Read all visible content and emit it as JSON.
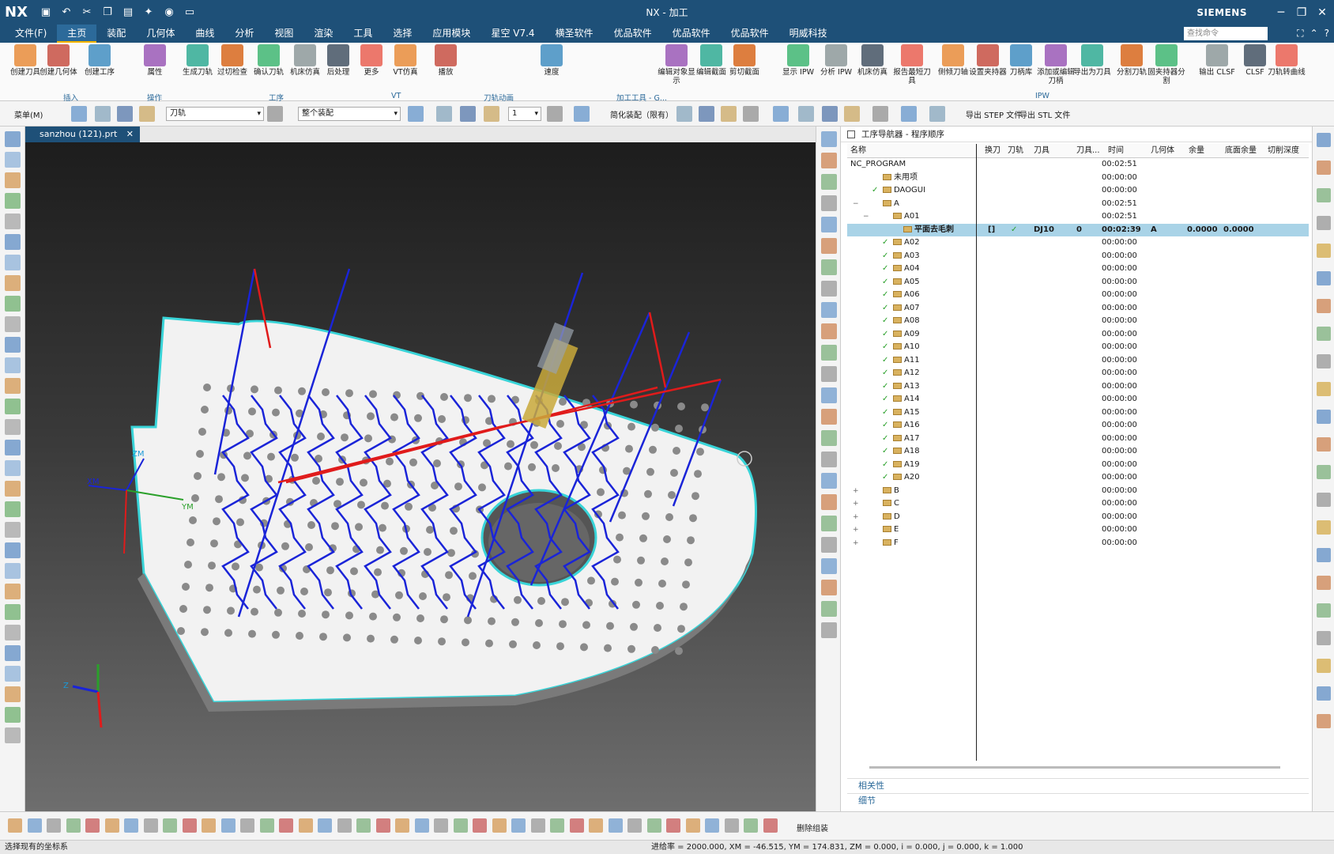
{
  "titlebar": {
    "logo": "NX",
    "title": "NX - 加工",
    "brand": "SIEMENS",
    "window_controls": [
      "minimize-icon",
      "restore-icon",
      "close-icon"
    ]
  },
  "menubar": {
    "items": [
      "文件(F)",
      "主页",
      "装配",
      "几何体",
      "曲线",
      "分析",
      "视图",
      "渲染",
      "工具",
      "选择",
      "应用模块",
      "星空 V7.4",
      "横圣软件",
      "优品软件",
      "优品软件",
      "优品软件",
      "明威科技"
    ],
    "active": "主页",
    "search_placeholder": "查找命令"
  },
  "ribbon": {
    "buttons": [
      "创建刀具",
      "创建几何体",
      "创建工序",
      "属性",
      "生成刀轨",
      "过切检查",
      "确认刀轨",
      "机床仿真",
      "后处理",
      "更多",
      "VT仿真",
      "播放",
      "速度",
      "编辑对象显示",
      "编辑截面",
      "剪切截面",
      "显示 IPW",
      "分析 IPW",
      "机床仿真",
      "报告最短刀具",
      "侧倾刀轴",
      "设置夹持器",
      "刀柄库",
      "添加或编辑刀柄",
      "导出为刀具",
      "分割刀轨",
      "固夹持器分割",
      "输出 CLSF",
      "CLSF",
      "刀轨转曲线"
    ],
    "groups": [
      "插入",
      "操作",
      "工序",
      "VT",
      "刀轨动画",
      "加工工具 - G...",
      "IPW"
    ]
  },
  "toolbar2": {
    "menu_label": "菜单(M)",
    "filter_combo": "刀轨",
    "scope_combo": "整个装配",
    "layer_combo": "1",
    "simplified_label": "简化装配（限有）",
    "export_step": "导出 STEP 文件",
    "export_stl": "导出 STL 文件"
  },
  "filetab": {
    "name": "sanzhou (121).prt"
  },
  "viewport": {
    "axis_labels": [
      "ZM",
      "YM",
      "XM",
      "Z"
    ]
  },
  "navigator": {
    "title": "工序导航器 - 程序顺序",
    "columns": [
      "名称",
      "换刀",
      "刀轨",
      "刀具",
      "刀具...",
      "时间",
      "几何体",
      "余量",
      "底面余量",
      "切削深度"
    ],
    "rows": [
      {
        "name": "NC_PROGRAM",
        "time": "00:02:51",
        "level": 0
      },
      {
        "name": "未用项",
        "time": "00:00:00",
        "level": 1
      },
      {
        "name": "DAOGUI",
        "time": "00:00:00",
        "level": 1,
        "check": true
      },
      {
        "name": "A",
        "time": "00:02:51",
        "level": 1,
        "expanded": true
      },
      {
        "name": "A01",
        "time": "00:02:51",
        "level": 2,
        "expanded": true
      },
      {
        "name": "平面去毛刺",
        "time": "00:02:39",
        "level": 3,
        "selected": true,
        "tool": "DJ10",
        "tool_no": "0",
        "geometry": "A",
        "stock": "0.0000",
        "floor_stock": "0.0000",
        "toolchange": "[]",
        "path_ok": true
      },
      {
        "name": "A02",
        "time": "00:00:00",
        "level": 2,
        "check": true
      },
      {
        "name": "A03",
        "time": "00:00:00",
        "level": 2,
        "check": true
      },
      {
        "name": "A04",
        "time": "00:00:00",
        "level": 2,
        "check": true
      },
      {
        "name": "A05",
        "time": "00:00:00",
        "level": 2,
        "check": true
      },
      {
        "name": "A06",
        "time": "00:00:00",
        "level": 2,
        "check": true
      },
      {
        "name": "A07",
        "time": "00:00:00",
        "level": 2,
        "check": true
      },
      {
        "name": "A08",
        "time": "00:00:00",
        "level": 2,
        "check": true
      },
      {
        "name": "A09",
        "time": "00:00:00",
        "level": 2,
        "check": true
      },
      {
        "name": "A10",
        "time": "00:00:00",
        "level": 2,
        "check": true
      },
      {
        "name": "A11",
        "time": "00:00:00",
        "level": 2,
        "check": true
      },
      {
        "name": "A12",
        "time": "00:00:00",
        "level": 2,
        "check": true
      },
      {
        "name": "A13",
        "time": "00:00:00",
        "level": 2,
        "check": true
      },
      {
        "name": "A14",
        "time": "00:00:00",
        "level": 2,
        "check": true
      },
      {
        "name": "A15",
        "time": "00:00:00",
        "level": 2,
        "check": true
      },
      {
        "name": "A16",
        "time": "00:00:00",
        "level": 2,
        "check": true
      },
      {
        "name": "A17",
        "time": "00:00:00",
        "level": 2,
        "check": true
      },
      {
        "name": "A18",
        "time": "00:00:00",
        "level": 2,
        "check": true
      },
      {
        "name": "A19",
        "time": "00:00:00",
        "level": 2,
        "check": true
      },
      {
        "name": "A20",
        "time": "00:00:00",
        "level": 2,
        "check": true
      },
      {
        "name": "B",
        "time": "00:00:00",
        "level": 1,
        "collapsed": true
      },
      {
        "name": "C",
        "time": "00:00:00",
        "level": 1,
        "collapsed": true
      },
      {
        "name": "D",
        "time": "00:00:00",
        "level": 1,
        "collapsed": true
      },
      {
        "name": "E",
        "time": "00:00:00",
        "level": 1,
        "collapsed": true
      },
      {
        "name": "F",
        "time": "00:00:00",
        "level": 1,
        "collapsed": true
      }
    ],
    "sections": [
      "相关性",
      "细节"
    ]
  },
  "bottombar": {
    "delete_label": "删除组装"
  },
  "status": {
    "left": "选择现有的坐标系",
    "right": "进给率 = 2000.000, XM = -46.515, YM = 174.831, ZM = 0.000, i = 0.000, j = 0.000, k = 1.000"
  },
  "colors": {
    "title_bg": "#1e5078",
    "selected_row": "#a9d3e7",
    "check": "#2aa02a",
    "toolpath_blue": "#1a24d8",
    "toolpath_red": "#e01b1b",
    "part_outline": "#38d4d8"
  }
}
